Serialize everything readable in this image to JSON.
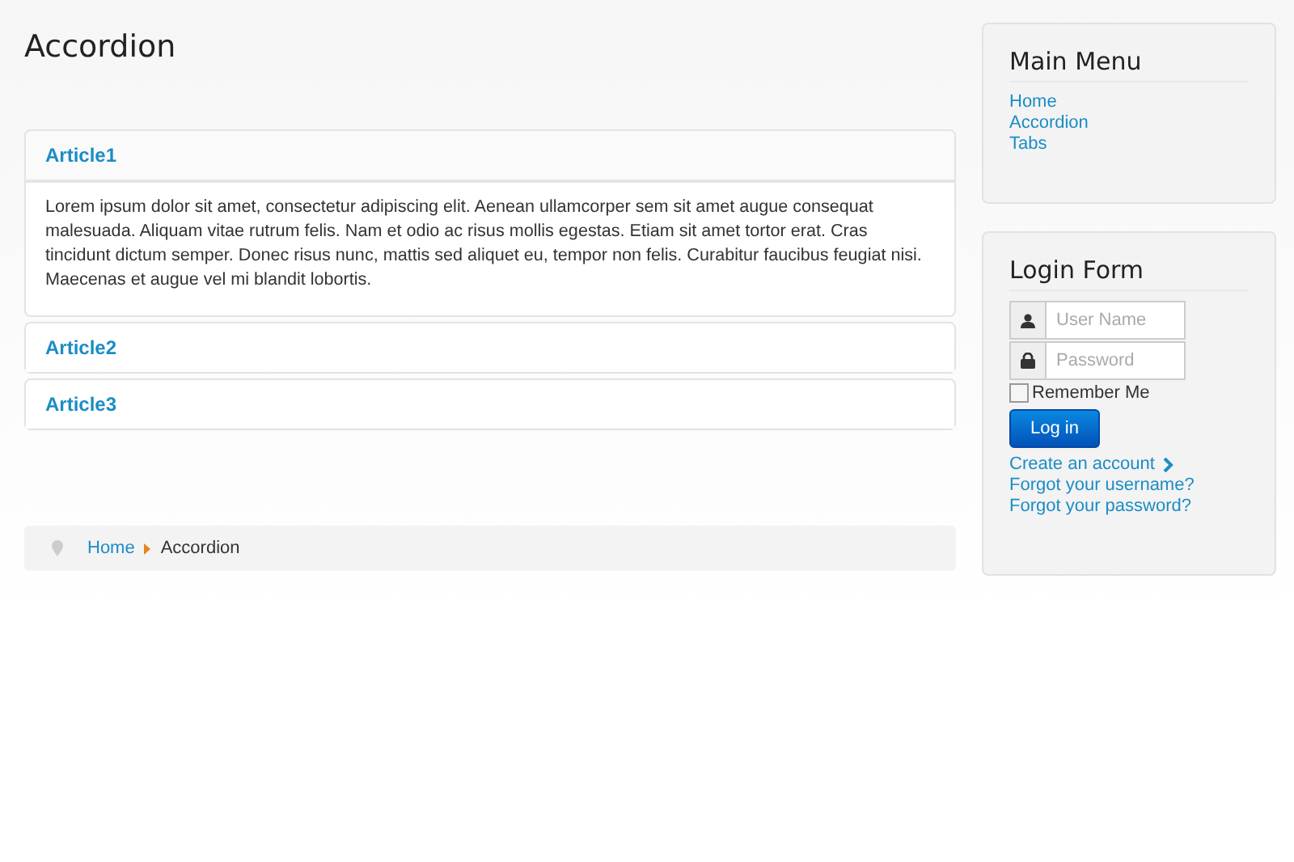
{
  "page_title": "Accordion",
  "accordion": [
    {
      "title": "Article1",
      "expanded": true,
      "body": "Lorem ipsum dolor sit amet, consectetur adipiscing elit. Aenean ullamcorper sem sit amet augue consequat malesuada. Aliquam vitae rutrum felis. Nam et odio ac risus mollis egestas. Etiam sit amet tortor erat. Cras tincidunt dictum semper. Donec risus nunc, mattis sed aliquet eu, tempor non felis. Curabitur faucibus feugiat nisi. Maecenas et augue vel mi blandit lobortis."
    },
    {
      "title": "Article2",
      "expanded": false
    },
    {
      "title": "Article3",
      "expanded": false
    }
  ],
  "breadcrumb": [
    {
      "label": "Home",
      "kind": "link"
    },
    {
      "label": "Accordion",
      "kind": "current"
    }
  ],
  "main_menu": {
    "title": "Main Menu",
    "items": [
      "Home",
      "Accordion",
      "Tabs"
    ]
  },
  "login_form": {
    "title": "Login Form",
    "username": {
      "placeholder": "User Name"
    },
    "password": {
      "placeholder": "Password"
    },
    "remember": {
      "label": "Remember Me",
      "checked": false
    },
    "button": "Log in",
    "links": [
      {
        "label": "Create an account",
        "kind": "chevron"
      },
      {
        "label": "Forgot your username?",
        "kind": "plain"
      },
      {
        "label": "Forgot your password?",
        "kind": "plain"
      }
    ]
  }
}
